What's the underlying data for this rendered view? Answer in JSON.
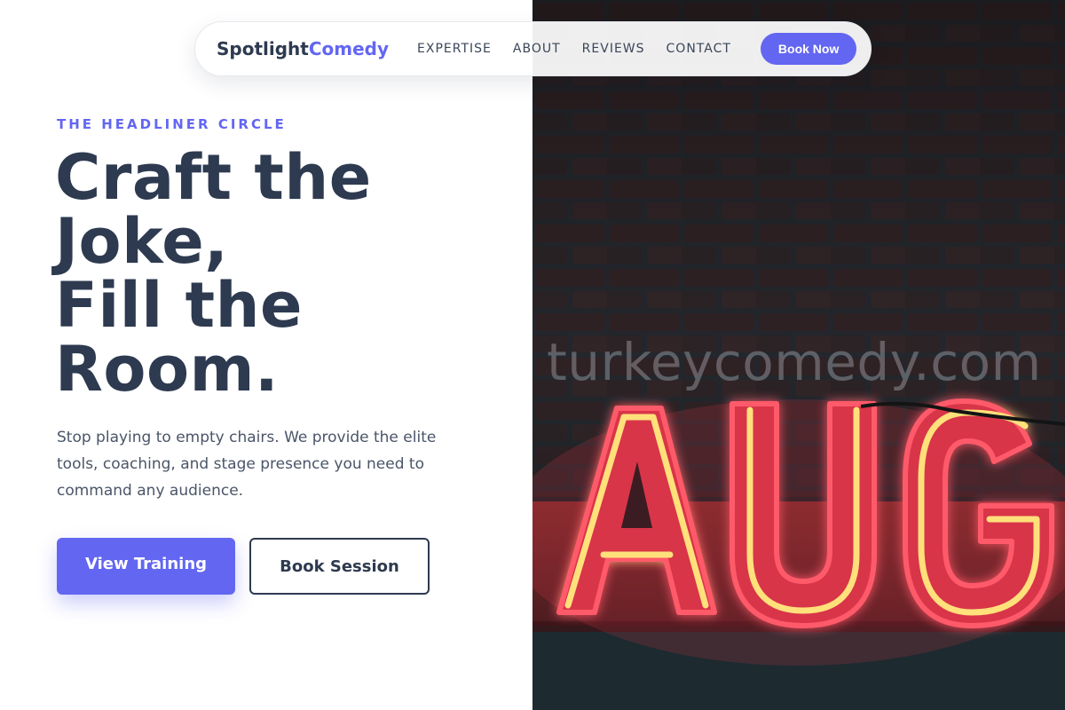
{
  "nav": {
    "logo_primary": "Spotlight",
    "logo_accent": "Comedy",
    "links": [
      "EXPERTISE",
      "ABOUT",
      "REVIEWS",
      "CONTACT"
    ],
    "cta_label": "Book Now"
  },
  "hero": {
    "eyebrow": "THE HEADLINER CIRCLE",
    "headline_lines": [
      "Craft the",
      "Joke,",
      "Fill the",
      "Room."
    ],
    "subtext": "Stop playing to empty chairs. We provide the elite tools, coaching, and stage presence you need to command any audience.",
    "primary_button": "View Training",
    "secondary_button": "Book Session"
  },
  "image": {
    "watermark": "turkeycomedy.com",
    "sign_letters": [
      "A",
      "U",
      "G"
    ]
  },
  "colors": {
    "accent": "#6366f1",
    "heading": "#2d3a50",
    "neon_red": "#e83a4c",
    "neon_yellow": "#ffd86b"
  }
}
